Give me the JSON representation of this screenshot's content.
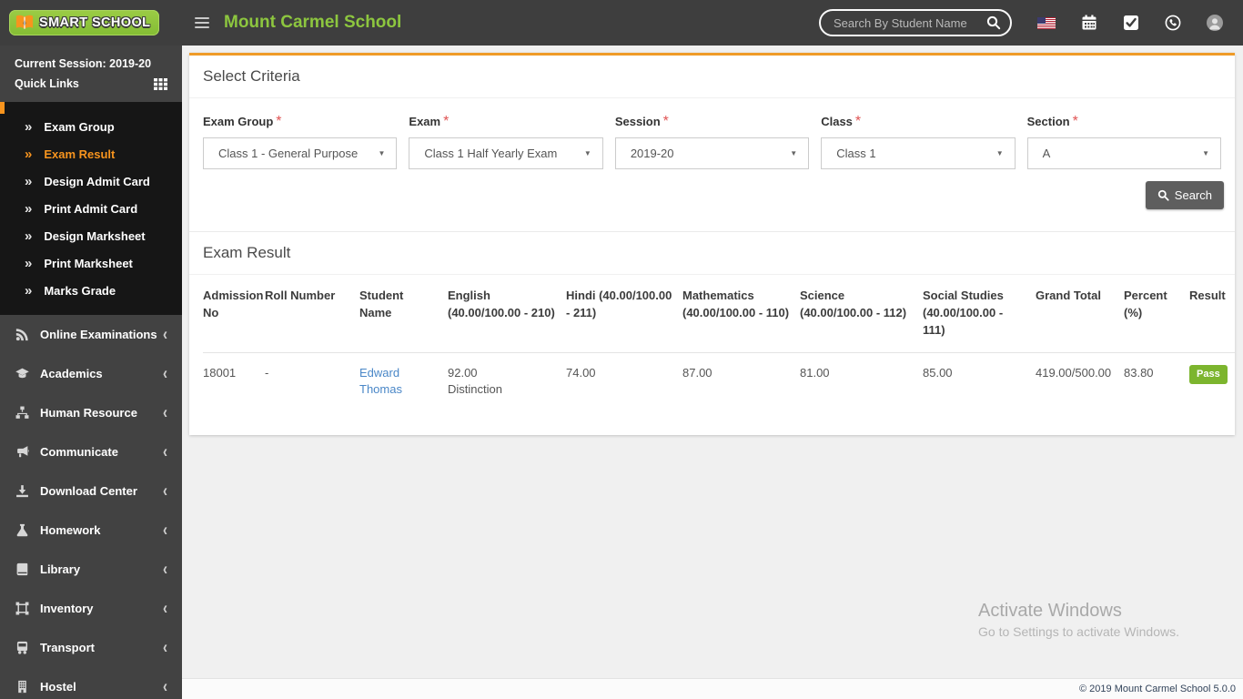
{
  "colors": {
    "accent_orange": "#f7941e",
    "brand_green": "#8dc63f",
    "pass_green": "#7cb52e",
    "link_blue": "#4a87c7"
  },
  "header": {
    "logo_text": "SMART SCHOOL",
    "school_name": "Mount Carmel School",
    "search_placeholder": "Search By Student Name"
  },
  "sidebar": {
    "current_session": "Current Session: 2019-20",
    "quick_links_label": "Quick Links",
    "submenu": [
      {
        "label": "Exam Group",
        "active": false
      },
      {
        "label": "Exam Result",
        "active": true
      },
      {
        "label": "Design Admit Card",
        "active": false
      },
      {
        "label": "Print Admit Card",
        "active": false
      },
      {
        "label": "Design Marksheet",
        "active": false
      },
      {
        "label": "Print Marksheet",
        "active": false
      },
      {
        "label": "Marks Grade",
        "active": false
      }
    ],
    "sections": [
      {
        "icon": "rss-icon",
        "label": "Online Examinations"
      },
      {
        "icon": "graduation-cap-icon",
        "label": "Academics"
      },
      {
        "icon": "sitemap-icon",
        "label": "Human Resource"
      },
      {
        "icon": "bullhorn-icon",
        "label": "Communicate"
      },
      {
        "icon": "download-icon",
        "label": "Download Center"
      },
      {
        "icon": "flask-icon",
        "label": "Homework"
      },
      {
        "icon": "book-icon",
        "label": "Library"
      },
      {
        "icon": "box-icon",
        "label": "Inventory"
      },
      {
        "icon": "bus-icon",
        "label": "Transport"
      },
      {
        "icon": "building-icon",
        "label": "Hostel"
      }
    ]
  },
  "criteria": {
    "title": "Select Criteria",
    "required_mark": "*",
    "fields": [
      {
        "label": "Exam Group",
        "value": "Class 1 - General Purpose"
      },
      {
        "label": "Exam",
        "value": "Class 1 Half Yearly Exam"
      },
      {
        "label": "Session",
        "value": "2019-20"
      },
      {
        "label": "Class",
        "value": "Class 1"
      },
      {
        "label": "Section",
        "value": "A"
      }
    ],
    "search_button": "Search"
  },
  "results": {
    "title": "Exam Result",
    "columns": [
      "Admission No",
      "Roll Number",
      "Student Name",
      "English (40.00/100.00 - 210)",
      "Hindi (40.00/100.00 - 211)",
      "Mathematics (40.00/100.00 - 110)",
      "Science (40.00/100.00 - 112)",
      "Social Studies (40.00/100.00 - 111)",
      "Grand Total",
      "Percent (%)",
      "Result"
    ],
    "rows": [
      {
        "cells": [
          "18001",
          "-",
          "Edward Thomas",
          "92.00\nDistinction",
          "74.00",
          "87.00",
          "81.00",
          "85.00",
          "419.00/500.00",
          "83.80",
          "Pass"
        ]
      }
    ]
  },
  "watermark": {
    "line1": "Activate Windows",
    "line2": "Go to Settings to activate Windows."
  },
  "footer": {
    "copyright": "© 2019 Mount Carmel School 5.0.0"
  }
}
